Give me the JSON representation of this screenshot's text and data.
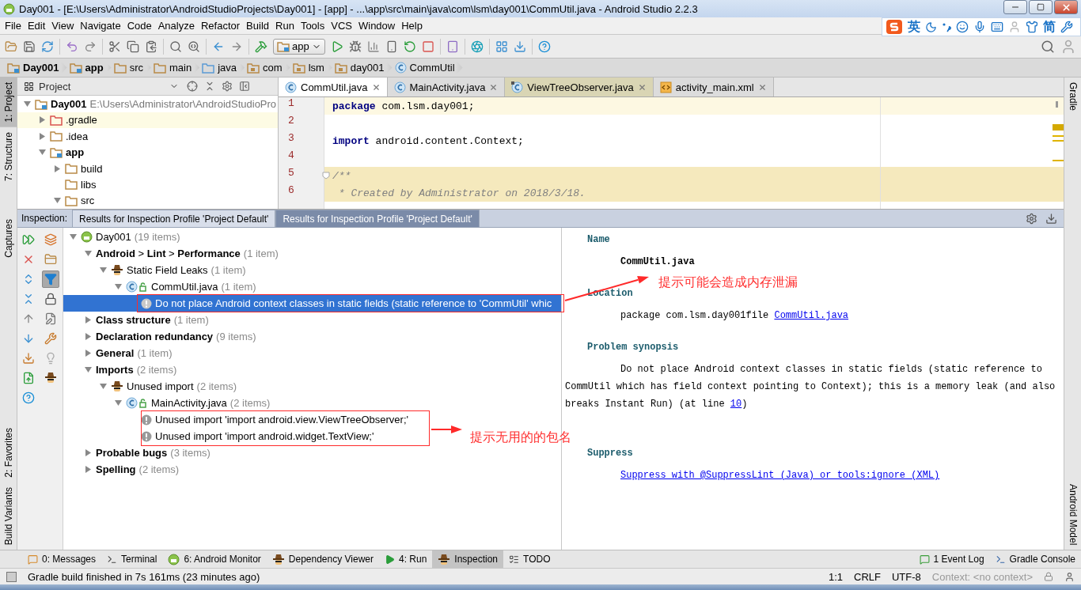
{
  "window": {
    "title": "Day001 - [E:\\Users\\Administrator\\AndroidStudioProjects\\Day001] - [app] - ...\\app\\src\\main\\java\\com\\lsm\\day001\\CommUtil.java - Android Studio 2.2.3"
  },
  "ime_bar": {
    "language": "英",
    "script": "简"
  },
  "menu": [
    "File",
    "Edit",
    "View",
    "Navigate",
    "Code",
    "Analyze",
    "Refactor",
    "Build",
    "Run",
    "Tools",
    "VCS",
    "Window",
    "Help"
  ],
  "toolbar": {
    "run_config": "app"
  },
  "breadcrumb": [
    {
      "label": "Day001",
      "bold": true,
      "kind": "module"
    },
    {
      "label": "app",
      "bold": true,
      "kind": "module"
    },
    {
      "label": "src",
      "bold": false,
      "kind": "folder"
    },
    {
      "label": "main",
      "bold": false,
      "kind": "folder"
    },
    {
      "label": "java",
      "bold": false,
      "kind": "source"
    },
    {
      "label": "com",
      "bold": false,
      "kind": "package"
    },
    {
      "label": "lsm",
      "bold": false,
      "kind": "package"
    },
    {
      "label": "day001",
      "bold": false,
      "kind": "package"
    },
    {
      "label": "CommUtil",
      "bold": false,
      "kind": "class"
    }
  ],
  "left_tool_tabs": [
    {
      "label": "1: Project",
      "selected": true
    },
    {
      "label": "7: Structure",
      "selected": false
    },
    {
      "label": "Captures",
      "selected": false
    },
    {
      "label": "2: Favorites",
      "selected": false
    },
    {
      "label": "Build Variants",
      "selected": false
    }
  ],
  "right_tool_tabs": [
    {
      "label": "Gradle"
    },
    {
      "label": "Android Model"
    }
  ],
  "project_panel": {
    "view": "Project",
    "tree": [
      {
        "label": "Day001",
        "path": "E:\\Users\\Administrator\\AndroidStudioPro",
        "bold": true,
        "kind": "module",
        "expanded": true,
        "selected": false,
        "children": [
          {
            "label": ".gradle",
            "bold": false,
            "kind": "excluded",
            "expanded": false,
            "selected": true
          },
          {
            "label": ".idea",
            "bold": false,
            "kind": "folder",
            "expanded": false,
            "selected": false
          },
          {
            "label": "app",
            "bold": true,
            "kind": "module",
            "expanded": true,
            "selected": false,
            "children": [
              {
                "label": "build",
                "bold": false,
                "kind": "folder",
                "expanded": false,
                "selected": false
              },
              {
                "label": "libs",
                "bold": false,
                "kind": "folder",
                "selected": false
              },
              {
                "label": "src",
                "bold": false,
                "kind": "folder",
                "expanded": true,
                "selected": false
              }
            ]
          }
        ]
      }
    ]
  },
  "editor": {
    "tabs": [
      {
        "label": "CommUtil.java",
        "kind": "class",
        "selected": true
      },
      {
        "label": "MainActivity.java",
        "kind": "class",
        "selected": false
      },
      {
        "label": "ViewTreeObserver.java",
        "kind": "library",
        "selected": false
      },
      {
        "label": "activity_main.xml",
        "kind": "xml",
        "selected": false
      }
    ],
    "lines": [
      {
        "number": "1",
        "kind": "code",
        "text": "**package** com.lsm.day001;",
        "current": true
      },
      {
        "number": "2",
        "kind": "blank",
        "current": false
      },
      {
        "number": "3",
        "kind": "code",
        "text": "**import** android.content.Context;",
        "current": false
      },
      {
        "number": "4",
        "kind": "blank",
        "current": false
      },
      {
        "number": "5",
        "kind": "comment",
        "text": "/**",
        "current": false,
        "fold": true
      },
      {
        "number": "6",
        "kind": "comment",
        "text": " * Created by Administrator on 2018/3/18.",
        "current": false
      }
    ]
  },
  "inspection": {
    "label": "Inspection:",
    "tabs": [
      {
        "label": "Results for Inspection Profile 'Project Default'",
        "selected": false
      },
      {
        "label": "Results for Inspection Profile 'Project Default'",
        "selected": true
      }
    ],
    "filter_on": true,
    "tree": [
      {
        "label": "Day001",
        "count": "(19 items)",
        "bold": false,
        "kind": "android",
        "expanded": true,
        "selected": false,
        "children": [
          {
            "label": "**Android** > **Lint** > **Performance**",
            "count": "(1 item)",
            "bold": false,
            "expanded": true,
            "selected": false,
            "children": [
              {
                "label": "Static Field Leaks",
                "count": "(1 item)",
                "bold": false,
                "kind": "inspector",
                "expanded": true,
                "selected": false,
                "children": [
                  {
                    "label": "CommUtil.java",
                    "count": "(1 item)",
                    "bold": false,
                    "kind": "class",
                    "expanded": true,
                    "selected": false,
                    "children": [
                      {
                        "label": "Do not place Android context classes in static fields (static reference to 'CommUtil' whic",
                        "bold": false,
                        "kind": "warning",
                        "selected": true
                      }
                    ]
                  }
                ]
              }
            ]
          },
          {
            "label": "Class structure",
            "count": "(1 item)",
            "bold": true,
            "expanded": false,
            "selected": false
          },
          {
            "label": "Declaration redundancy",
            "count": "(9 items)",
            "bold": true,
            "expanded": false,
            "selected": false
          },
          {
            "label": "General",
            "count": "(1 item)",
            "bold": true,
            "expanded": false,
            "selected": false
          },
          {
            "label": "Imports",
            "count": "(2 items)",
            "bold": true,
            "expanded": true,
            "selected": false,
            "children": [
              {
                "label": "Unused import",
                "count": "(2 items)",
                "bold": false,
                "kind": "inspector",
                "expanded": true,
                "selected": false,
                "children": [
                  {
                    "label": "MainActivity.java",
                    "count": "(2 items)",
                    "bold": false,
                    "kind": "class",
                    "expanded": true,
                    "selected": false,
                    "children": [
                      {
                        "label": "Unused import 'import android.view.ViewTreeObserver;'",
                        "bold": false,
                        "kind": "warning",
                        "selected": false
                      },
                      {
                        "label": "Unused import 'import android.widget.TextView;'",
                        "bold": false,
                        "kind": "warning",
                        "selected": false
                      }
                    ]
                  }
                ]
              }
            ]
          },
          {
            "label": "Probable bugs",
            "count": "(3 items)",
            "bold": true,
            "expanded": false,
            "selected": false
          },
          {
            "label": "Spelling",
            "count": "(2 items)",
            "bold": true,
            "expanded": false,
            "selected": false
          }
        ]
      }
    ],
    "details": [
      {
        "heading": "Name",
        "kind": "name",
        "text": "CommUtil.java"
      },
      {
        "heading": "Location",
        "kind": "location",
        "text": "package  com.lsm.day001file",
        "link": "CommUtil.java"
      },
      {
        "heading": "Problem synopsis",
        "kind": "paragraph",
        "text": "Do not place Android context classes in static fields (static reference to CommUtil which has field context pointing to Context); this is a memory leak (and also breaks Instant Run) (at line ",
        "link": "10",
        "tail": ")"
      },
      {
        "heading": "Suppress",
        "kind": "link",
        "link": "Suppress with @SuppressLint (Java) or tools:ignore (XML)"
      }
    ]
  },
  "bottom_tabs": [
    {
      "label": "0: Messages",
      "kind": "messages",
      "selected": false
    },
    {
      "label": "Terminal",
      "kind": "terminal",
      "selected": false
    },
    {
      "label": "6: Android Monitor",
      "kind": "android",
      "selected": false
    },
    {
      "label": "Dependency Viewer",
      "kind": "inspector",
      "selected": false
    },
    {
      "label": "4: Run",
      "kind": "run",
      "selected": false
    },
    {
      "label": "Inspection",
      "kind": "inspector",
      "selected": true
    },
    {
      "label": "TODO",
      "kind": "todo",
      "selected": false
    },
    {
      "label": "1 Event Log",
      "kind": "event",
      "selected": false
    },
    {
      "label": "Gradle Console",
      "kind": "console",
      "selected": false
    }
  ],
  "status_bar": {
    "message": "Gradle build finished in 7s 161ms (23 minutes ago)",
    "position": "1:1",
    "line_separator": "CRLF",
    "encoding": "UTF-8",
    "context": "Context: <no context>"
  },
  "annotations": [
    {
      "text": "提示可能会造成内存泄漏"
    },
    {
      "text": "提示无用的的包名"
    }
  ]
}
